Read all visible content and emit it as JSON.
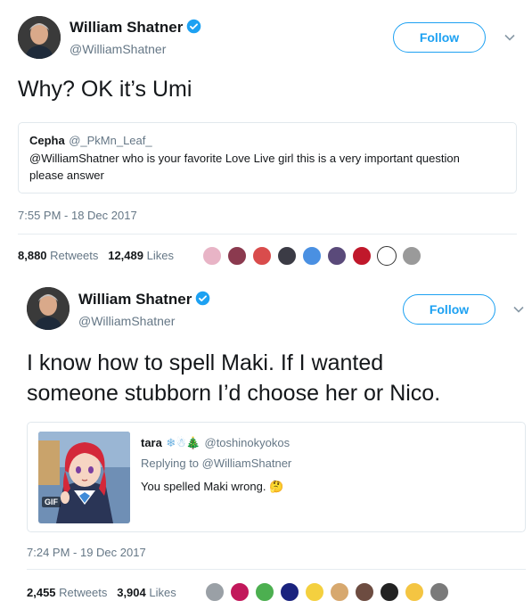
{
  "tweet1": {
    "name": "William Shatner",
    "handle": "@WilliamShatner",
    "follow_label": "Follow",
    "text": "Why? OK it’s Umi",
    "quote": {
      "name": "Cepha",
      "handle": "@_PkMn_Leaf_",
      "text_line1": "@WilliamShatner who is your favorite Love Live girl this is a very important question",
      "text_line2": "please answer"
    },
    "timestamp": "7:55 PM - 18 Dec 2017",
    "retweets_count": "8,880",
    "retweets_label": "Retweets",
    "likes_count": "12,489",
    "likes_label": "Likes",
    "liker_colors": [
      "#e8b4c6",
      "#8b3a4f",
      "#d94c4c",
      "#3b3b45",
      "#4a90e2",
      "#5a4a7a",
      "#c0182b",
      "#ffffff",
      "#9a9a9a"
    ]
  },
  "tweet2": {
    "name": "William Shatner",
    "handle": "@WilliamShatner",
    "follow_label": "Follow",
    "text_line1": "I know how to spell Maki. If I wanted",
    "text_line2": "someone stubborn I’d choose her or Nico.",
    "quote": {
      "name": "tara",
      "name_emoji": "❄☃🎄",
      "handle": "@toshinokyokos",
      "replying_to": "Replying to @WilliamShatner",
      "text": "You spelled Maki wrong. 🤔",
      "media_badge": "GIF"
    },
    "timestamp": "7:24 PM - 19 Dec 2017",
    "retweets_count": "2,455",
    "retweets_label": "Retweets",
    "likes_count": "3,904",
    "likes_label": "Likes",
    "liker_colors": [
      "#9aa0a6",
      "#c2185b",
      "#4caf50",
      "#1a237e",
      "#f4d03f",
      "#d7a86e",
      "#6d4c41",
      "#222222",
      "#f4c542",
      "#7a7a7a"
    ]
  },
  "colors": {
    "accent": "#1da1f2",
    "text": "#14171a",
    "muted": "#657786",
    "border": "#e1e8ed"
  }
}
